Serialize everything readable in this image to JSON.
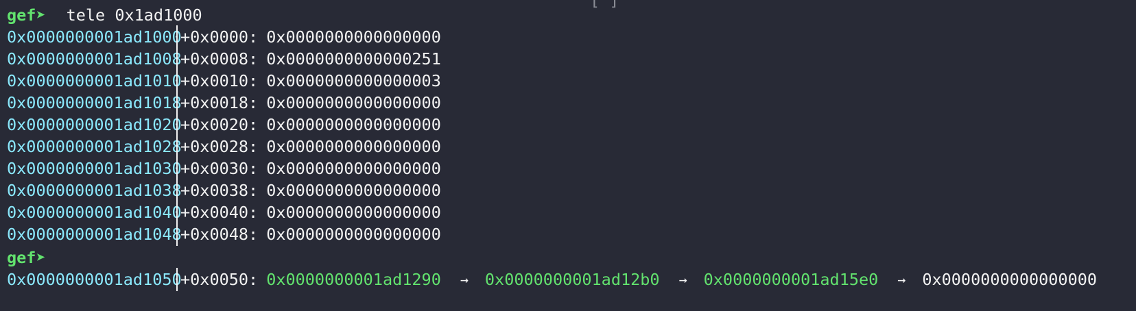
{
  "top_fragment": "[ ]",
  "prompt_label": "gef➤",
  "command": "tele 0x1ad1000",
  "rows": [
    {
      "addr": "0x0000000001ad1000",
      "off": "+0x0000:",
      "val": "0x0000000000000000"
    },
    {
      "addr": "0x0000000001ad1008",
      "off": "+0x0008:",
      "val": "0x0000000000000251"
    },
    {
      "addr": "0x0000000001ad1010",
      "off": "+0x0010:",
      "val": "0x0000000000000003"
    },
    {
      "addr": "0x0000000001ad1018",
      "off": "+0x0018:",
      "val": "0x0000000000000000"
    },
    {
      "addr": "0x0000000001ad1020",
      "off": "+0x0020:",
      "val": "0x0000000000000000"
    },
    {
      "addr": "0x0000000001ad1028",
      "off": "+0x0028:",
      "val": "0x0000000000000000"
    },
    {
      "addr": "0x0000000001ad1030",
      "off": "+0x0030:",
      "val": "0x0000000000000000"
    },
    {
      "addr": "0x0000000001ad1038",
      "off": "+0x0038:",
      "val": "0x0000000000000000"
    },
    {
      "addr": "0x0000000001ad1040",
      "off": "+0x0040:",
      "val": "0x0000000000000000"
    },
    {
      "addr": "0x0000000001ad1048",
      "off": "+0x0048:",
      "val": "0x0000000000000000"
    }
  ],
  "prompt2_label": "gef➤",
  "chain_row": {
    "addr": "0x0000000001ad1050",
    "off": "+0x0050:",
    "p1": "0x0000000001ad1290",
    "p2": "0x0000000001ad12b0",
    "p3": "0x0000000001ad15e0",
    "end": "0x0000000000000000",
    "arrow": "→"
  },
  "colors": {
    "background": "#282a36",
    "prompt": "#62e26e",
    "address": "#8be9fd",
    "pointer": "#62e26e",
    "text": "#f2f2f2"
  }
}
